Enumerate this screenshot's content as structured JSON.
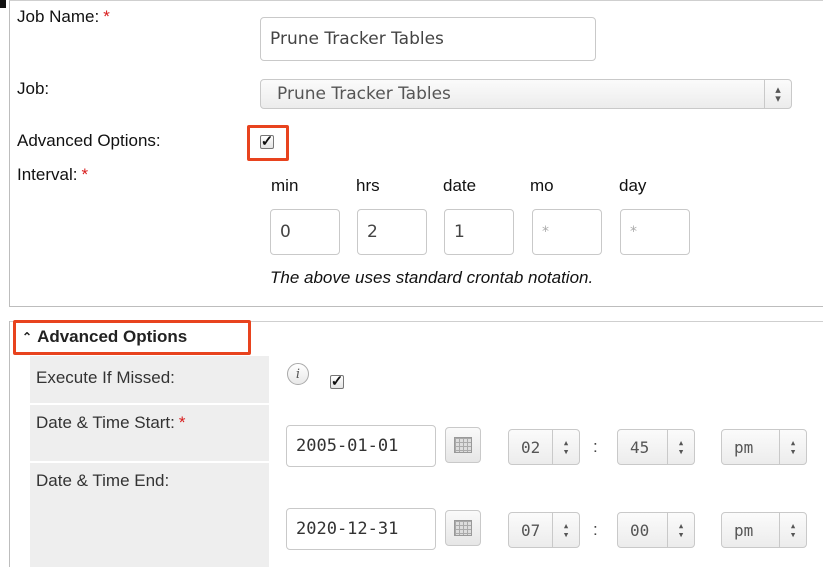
{
  "form": {
    "job_name_label": "Job Name:",
    "required_mark": "*",
    "job_name_value": "Prune Tracker Tables",
    "job_label": "Job:",
    "job_selected": "Prune Tracker Tables",
    "advanced_options_label": "Advanced Options:",
    "advanced_checked": true,
    "interval_label": "Interval:",
    "interval_headers": [
      "min",
      "hrs",
      "date",
      "mo",
      "day"
    ],
    "interval_values": [
      "0",
      "2",
      "1",
      "*",
      "*"
    ],
    "crontab_note": "The above uses standard crontab notation."
  },
  "advanced": {
    "toggle_icon": "double-chevron-up-icon",
    "title": "Advanced Options",
    "execute_if_missed_label": "Execute If Missed:",
    "info_glyph": "i",
    "execute_if_missed_checked": true,
    "start_label": "Date & Time Start:",
    "start_date": "2005-01-01",
    "start_hour": "02",
    "start_minute": "45",
    "start_ampm": "pm",
    "end_label": "Date & Time End:",
    "end_date": "2020-12-31",
    "end_hour": "07",
    "end_minute": "00",
    "end_ampm": "pm",
    "time_separator": ":"
  },
  "colors": {
    "highlight": "#e8431e",
    "required": "#d81b1b",
    "label_column": "#eeeeee"
  }
}
